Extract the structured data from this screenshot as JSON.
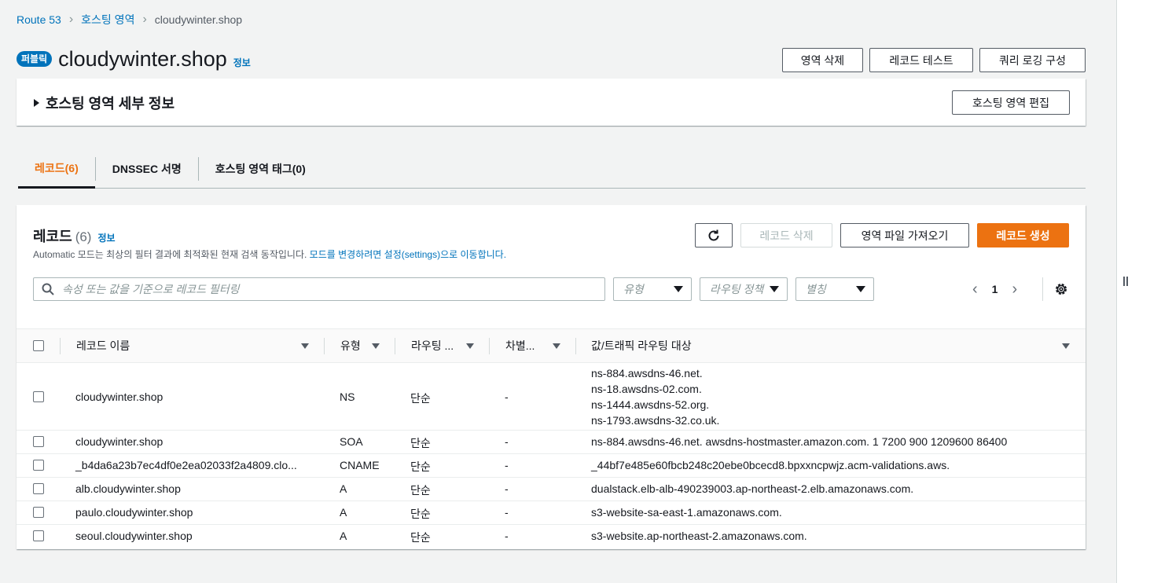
{
  "breadcrumb": {
    "root": "Route 53",
    "zones": "호스팅 영역",
    "current": "cloudywinter.shop"
  },
  "header": {
    "badge": "퍼블릭",
    "title": "cloudywinter.shop",
    "info": "정보"
  },
  "actions": {
    "delete_zone": "영역 삭제",
    "test_record": "레코드 테스트",
    "query_logging": "쿼리 로깅 구성"
  },
  "details": {
    "title": "호스팅 영역 세부 정보",
    "edit": "호스팅 영역 편집"
  },
  "tabs": [
    {
      "label": "레코드(6)"
    },
    {
      "label": "DNSSEC 서명"
    },
    {
      "label": "호스팅 영역 태그(0)"
    }
  ],
  "records": {
    "title": "레코드",
    "count": "(6)",
    "info": "정보",
    "desc": "Automatic 모드는 최상의 필터 결과에 최적화된 현재 검색 동작입니다.",
    "desc_link": "모드를 변경하려면 설정(settings)으로 이동합니다.",
    "delete": "레코드 삭제",
    "import": "영역 파일 가져오기",
    "create": "레코드 생성",
    "search_placeholder": "속성 또는 값을 기준으로 레코드 필터링",
    "filters": {
      "type": "유형",
      "routing": "라우팅 정책",
      "alias": "별칭"
    },
    "page": "1"
  },
  "columns": {
    "name": "레코드 이름",
    "type": "유형",
    "routing": "라우팅 ...",
    "diff": "차별...",
    "value": "값/트래픽 라우팅 대상"
  },
  "rows": [
    {
      "name": "cloudywinter.shop",
      "type": "NS",
      "routing": "단순",
      "diff": "-",
      "values": [
        "ns-884.awsdns-46.net.",
        "ns-18.awsdns-02.com.",
        "ns-1444.awsdns-52.org.",
        "ns-1793.awsdns-32.co.uk."
      ]
    },
    {
      "name": "cloudywinter.shop",
      "type": "SOA",
      "routing": "단순",
      "diff": "-",
      "value": "ns-884.awsdns-46.net. awsdns-hostmaster.amazon.com. 1 7200 900 1209600 86400"
    },
    {
      "name": "_b4da6a23b7ec4df0e2ea02033f2a4809.clo...",
      "type": "CNAME",
      "routing": "단순",
      "diff": "-",
      "value": "_44bf7e485e60fbcb248c20ebe0bcecd8.bpxxncpwjz.acm-validations.aws."
    },
    {
      "name": "alb.cloudywinter.shop",
      "type": "A",
      "routing": "단순",
      "diff": "-",
      "value": "dualstack.elb-alb-490239003.ap-northeast-2.elb.amazonaws.com."
    },
    {
      "name": "paulo.cloudywinter.shop",
      "type": "A",
      "routing": "단순",
      "diff": "-",
      "value": "s3-website-sa-east-1.amazonaws.com."
    },
    {
      "name": "seoul.cloudywinter.shop",
      "type": "A",
      "routing": "단순",
      "diff": "-",
      "value": "s3-website.ap-northeast-2.amazonaws.com."
    }
  ],
  "colors": {
    "accent": "#ec7211",
    "link": "#0073bb",
    "badge": "#0073bb"
  }
}
